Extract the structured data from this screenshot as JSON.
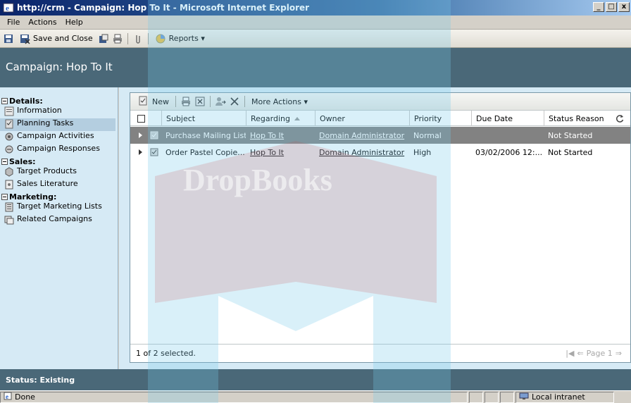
{
  "window": {
    "title": "http://crm - Campaign: Hop To It - Microsoft Internet Explorer",
    "btn_min": "_",
    "btn_max": "□",
    "btn_close": "x"
  },
  "menu": [
    "File",
    "Actions",
    "Help"
  ],
  "toolbar": {
    "save_close": "Save and Close",
    "reports": "Reports ▾"
  },
  "header": {
    "title": "Campaign: Hop To It"
  },
  "nav": {
    "sections": [
      {
        "label": "Details:",
        "items": [
          "Information",
          "Planning Tasks",
          "Campaign Activities",
          "Campaign Responses"
        ]
      },
      {
        "label": "Sales:",
        "items": [
          "Target Products",
          "Sales Literature"
        ]
      },
      {
        "label": "Marketing:",
        "items": [
          "Target Marketing Lists",
          "Related Campaigns"
        ]
      }
    ],
    "selected": "Planning Tasks"
  },
  "grid": {
    "toolbar": {
      "new": "New",
      "more_actions": "More Actions ▾"
    },
    "columns": [
      "Subject",
      "Regarding",
      "Owner",
      "Priority",
      "Due Date",
      "Status Reason"
    ],
    "rows": [
      {
        "subject": "Purchase Mailing List",
        "regarding": "Hop To It",
        "owner": "Domain Administrator",
        "priority": "Normal",
        "due": "",
        "status": "Not Started",
        "selected": true
      },
      {
        "subject": "Order Pastel Copie...",
        "regarding": "Hop To It",
        "owner": "Domain Administrator",
        "priority": "High",
        "due": "03/02/2006 12:...",
        "status": "Not Started",
        "selected": false
      }
    ],
    "footer": {
      "selection": "1 of 2 selected.",
      "page": "Page 1"
    }
  },
  "status": {
    "label": "Status: Existing"
  },
  "ie_status": {
    "text": "Done",
    "zone": "Local intranet"
  },
  "watermark": {
    "text": "DropBooks"
  }
}
